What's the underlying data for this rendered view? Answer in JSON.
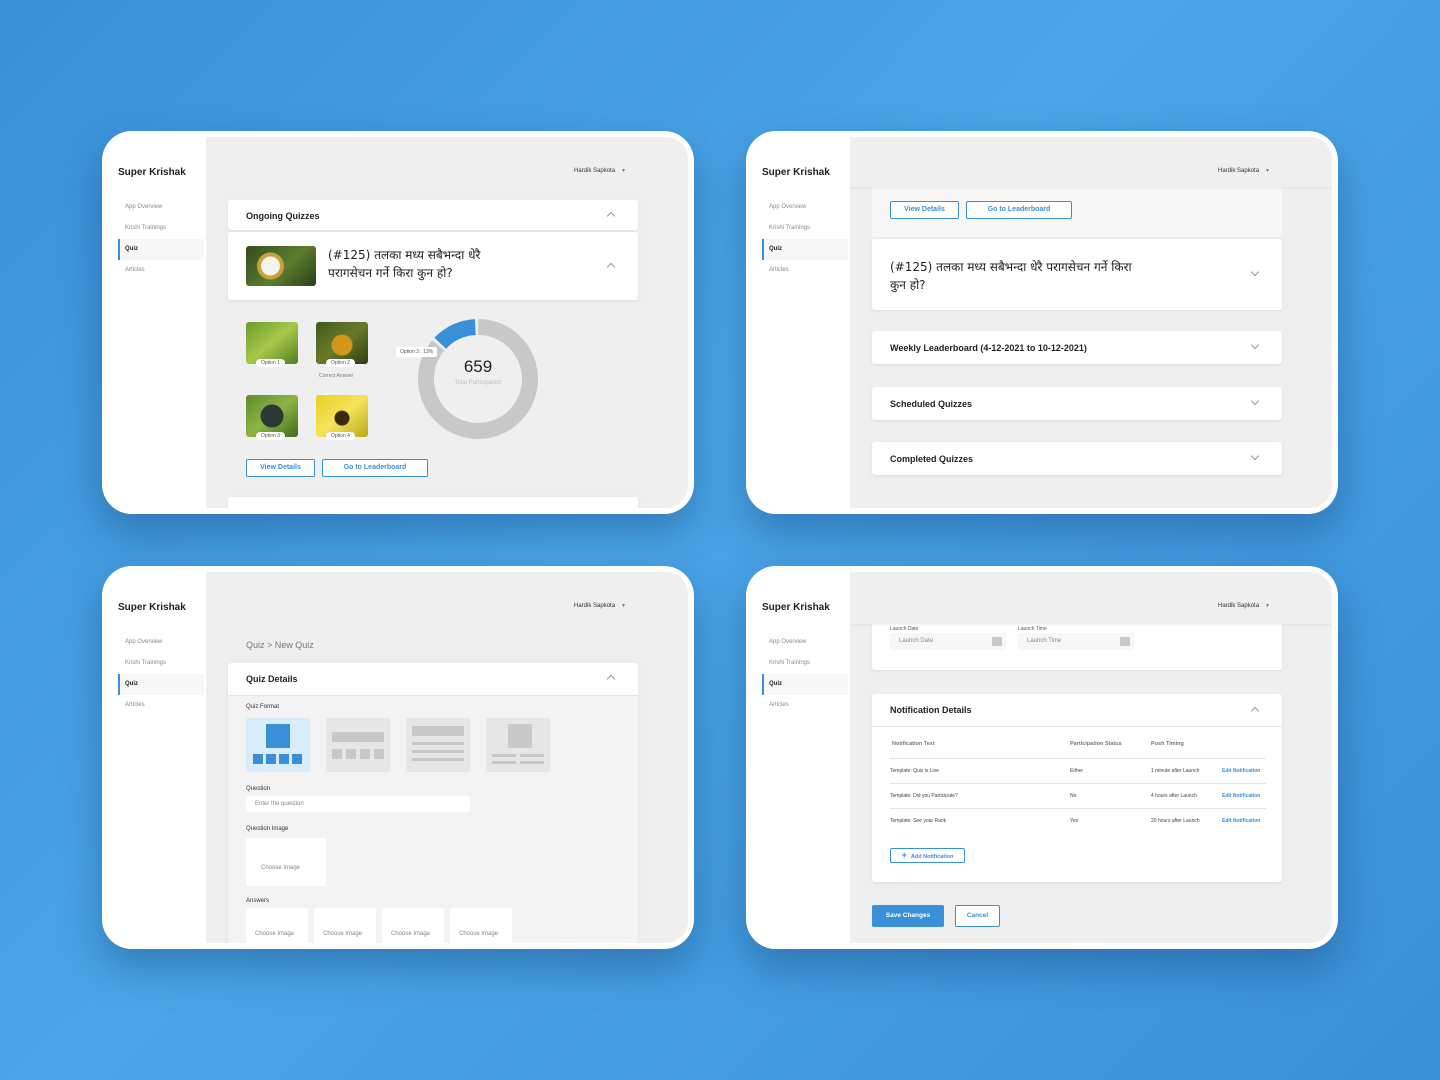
{
  "app": {
    "brand": "Super Krishak",
    "user": "Hardik Sapkota",
    "nav": [
      "App Overview",
      "Krishi Trainings",
      "Quiz",
      "Articles"
    ],
    "active_nav": "Quiz"
  },
  "screen1": {
    "section_title": "Ongoing Quizzes",
    "question": "(#125) तलका मध्य सबैभन्दा धेरै परागसेचन गर्ने किरा कुन हो?",
    "options": [
      {
        "label": "Option 1",
        "note": ""
      },
      {
        "label": "Option 2",
        "note": "Correct Answer"
      },
      {
        "label": "Option 3",
        "note": ""
      },
      {
        "label": "Option 4",
        "note": ""
      }
    ],
    "donut": {
      "total": "659",
      "total_label": "Total Participation",
      "callout": "Option 3 : 13%",
      "highlight_fraction": 0.13,
      "colors": {
        "highlight": "#3a8fd9",
        "rest": "#c8c8c8"
      }
    },
    "buttons": {
      "view_details": "View Details",
      "leaderboard": "Go to Leaderboard"
    }
  },
  "screen2": {
    "buttons": {
      "view_details": "View Details",
      "leaderboard": "Go to Leaderboard"
    },
    "question": "(#125) तलका मध्य सबैभन्दा धेरै परागसेचन गर्ने किरा कुन हो?",
    "sections": [
      "Weekly Leaderboard (4-12-2021 to 10-12-2021)",
      "Scheduled Quizzes",
      "Completed Quizzes"
    ]
  },
  "screen3": {
    "breadcrumb": "Quiz > New Quiz",
    "section_title": "Quiz Details",
    "quiz_format_label": "Quiz Format",
    "question_label": "Question",
    "question_placeholder": "Enter the question",
    "question_image_label": "Question Image",
    "choose_image": "Choose Image",
    "answers_label": "Answers",
    "answer_slots": [
      "Choose Image",
      "Choose Image",
      "Choose Image",
      "Choose Image"
    ]
  },
  "screen4": {
    "launch_date_label": "Launch Date",
    "launch_time_label": "Launch Time",
    "launch_date_placeholder": "Launch Date",
    "launch_time_placeholder": "Launch Time",
    "section_title": "Notification Details",
    "columns": [
      "Notification Text",
      "Participation Status",
      "Push Timing"
    ],
    "rows": [
      {
        "text": "Template: Quiz is Live",
        "status": "Either",
        "timing": "1 minute after Launch",
        "action": "Edit Notification"
      },
      {
        "text": "Template: Did you Participate?",
        "status": "No",
        "timing": "4 hours after Launch",
        "action": "Edit Notification"
      },
      {
        "text": "Template: See your Rank",
        "status": "Yes",
        "timing": "20 hours after Launch",
        "action": "Edit Notification"
      }
    ],
    "add_notification": "Add Notification",
    "save": "Save Changes",
    "cancel": "Cancel"
  }
}
